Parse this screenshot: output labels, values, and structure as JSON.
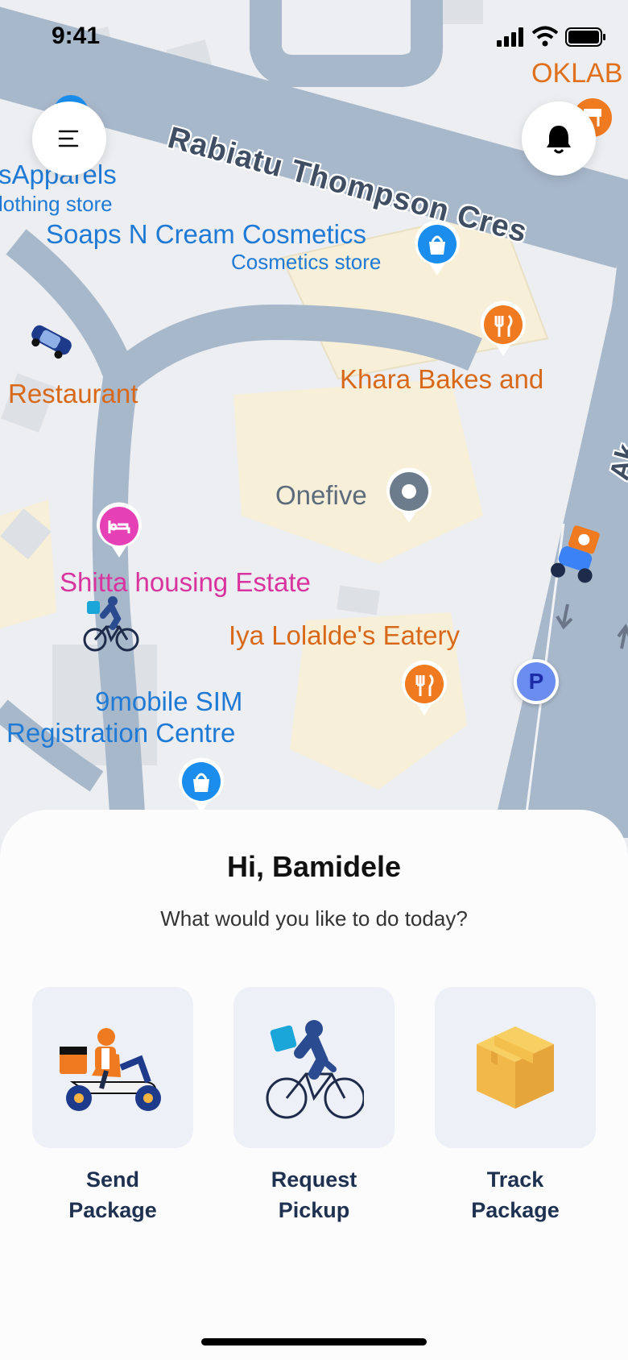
{
  "status_bar": {
    "time": "9:41"
  },
  "map": {
    "streets": [
      "Rabiatu Thompson Cres",
      "Ak"
    ],
    "places": [
      {
        "name": "sApparels",
        "category": "lothing store"
      },
      {
        "name": "Soaps N Cream Cosmetics",
        "category": "Cosmetics store"
      },
      {
        "name": "OKLAB"
      },
      {
        "name": "Restaurant"
      },
      {
        "name": "Khara Bakes and"
      },
      {
        "name": "Onefive"
      },
      {
        "name": "Shitta housing Estate"
      },
      {
        "name": "Iya Lolalde's Eatery"
      },
      {
        "name": "9mobile SIM",
        "name2": "Registration Centre"
      }
    ],
    "parking_label": "P"
  },
  "colors": {
    "blue_pin": "#1a8ded",
    "orange_pin": "#f07a20",
    "pink_pin": "#e540b5",
    "road": "#a8b8cb",
    "building": "#f7efd8"
  },
  "sheet": {
    "greeting": "Hi, Bamidele",
    "prompt": "What would you like to do today?",
    "actions": [
      {
        "line1": "Send",
        "line2": "Package",
        "icon": "scooter-courier-icon"
      },
      {
        "line1": "Request",
        "line2": "Pickup",
        "icon": "bicycle-courier-icon"
      },
      {
        "line1": "Track",
        "line2": "Package",
        "icon": "package-box-icon"
      }
    ]
  }
}
